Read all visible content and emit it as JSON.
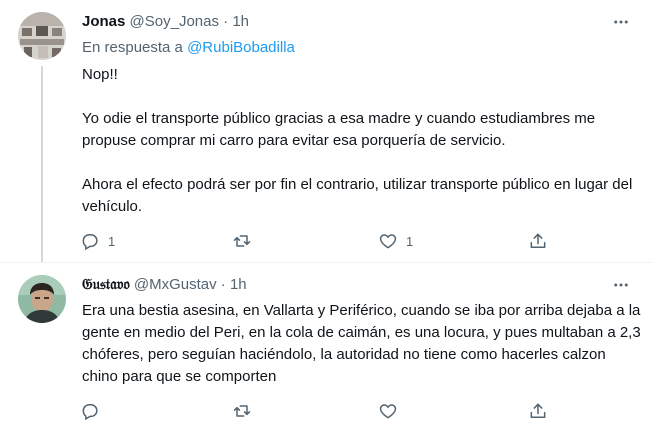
{
  "tweets": [
    {
      "name": "Jonas",
      "handle": "@Soy_Jonas",
      "separator": "·",
      "time": "1h",
      "reply_prefix": "En respuesta a",
      "reply_handle": "@RubiBobadilla",
      "text": "Nop!!\n\nYo odie el transporte público gracias a esa madre y cuando estudiambres me propuse comprar mi carro para evitar esa porquería de servicio.\n\nAhora el efecto podrá ser por fin el contrario, utilizar transporte público en lugar del vehículo.",
      "replies": "1",
      "retweets": "",
      "likes": "1"
    },
    {
      "name": "𝔊𝔲𝔰𝔱𝔞𝔳𝔬",
      "handle": "@MxGustav",
      "separator": "·",
      "time": "1h",
      "text": "Era una bestia asesina, en Vallarta y Periférico, cuando se iba por arriba dejaba a la gente en medio del Peri, en la cola de caimán, es una locura, y pues multaban a 2,3 chóferes, pero seguían haciéndolo, la autoridad no tiene como hacerles calzon chino para que se comporten",
      "replies": "",
      "retweets": "",
      "likes": ""
    }
  ],
  "icons": {
    "more": "more-icon",
    "reply": "reply-icon",
    "retweet": "retweet-icon",
    "like": "like-icon",
    "share": "share-icon"
  },
  "colors": {
    "link": "#1d9bf0",
    "secondary": "#536471",
    "divider": "#eff3f4"
  }
}
